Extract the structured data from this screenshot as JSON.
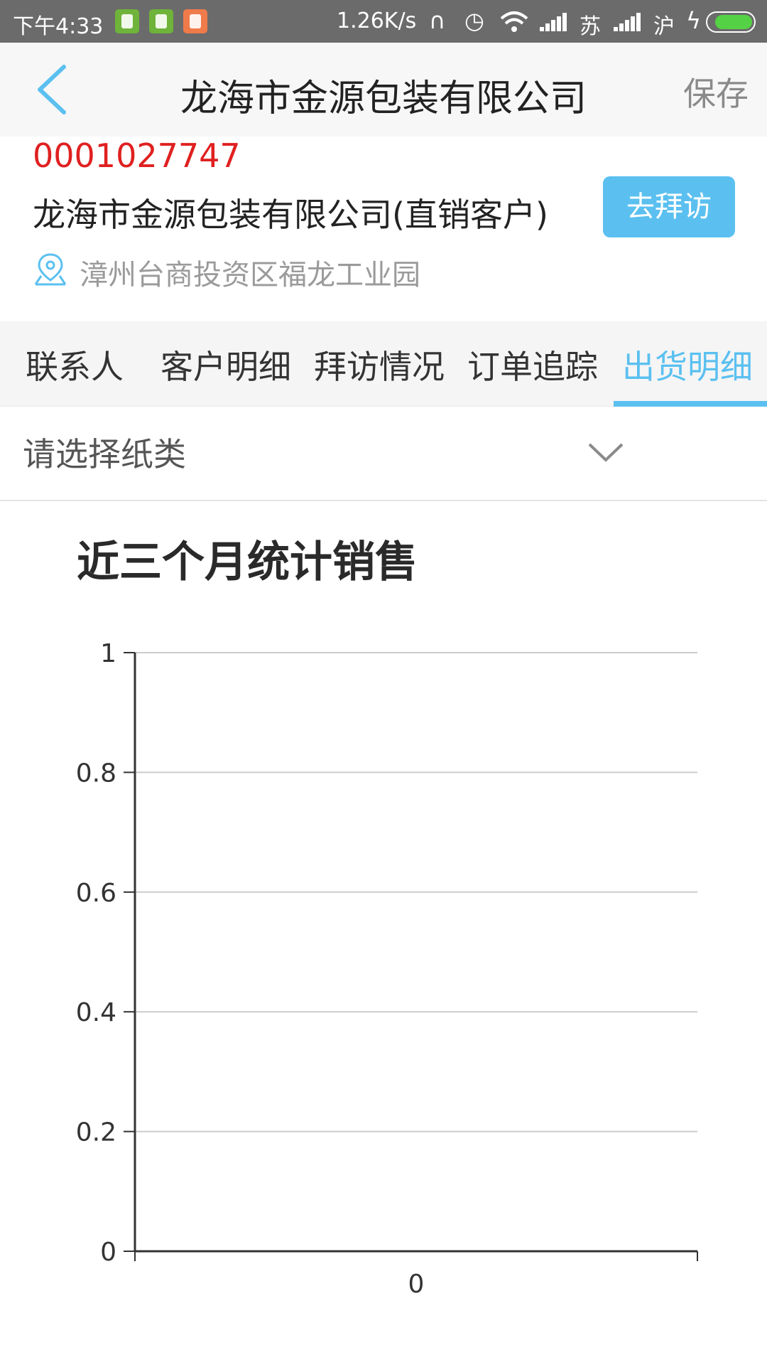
{
  "status_bar": {
    "time": "下午4:33",
    "network_speed": "1.26K/s",
    "carrier_1": "苏",
    "carrier_2": "沪",
    "icons": [
      "app-icon-shield",
      "app-icon-battery",
      "app-icon-mi",
      "headphone-icon",
      "alarm-icon",
      "wifi-icon",
      "signal-icon",
      "signal-icon",
      "charging-icon",
      "battery-icon"
    ],
    "battery_color": "#55d145"
  },
  "header": {
    "title": "龙海市金源包装有限公司",
    "save_label": "保存",
    "back_icon": "chevron-left-icon",
    "accent_color": "#5bc0f0"
  },
  "customer": {
    "code": "0001027747",
    "code_color": "#e02020",
    "name": "龙海市金源包装有限公司(直销客户)",
    "visit_button": "去拜访",
    "address": "漳州台商投资区福龙工业园",
    "location_icon": "location-pin-icon"
  },
  "tabs": [
    {
      "label": "联系人",
      "active": false
    },
    {
      "label": "客户明细",
      "active": false
    },
    {
      "label": "拜访情况",
      "active": false
    },
    {
      "label": "订单追踪",
      "active": false
    },
    {
      "label": "出货明细",
      "active": true
    }
  ],
  "filter": {
    "placeholder": "请选择纸类",
    "icon": "chevron-down-icon"
  },
  "chart_title": "近三个月统计销售",
  "chart_data": {
    "type": "bar",
    "title": "近三个月统计销售",
    "categories": [
      "0"
    ],
    "values": [],
    "ylim": [
      0,
      1
    ],
    "y_ticks": [
      "0",
      "0.2",
      "0.4",
      "0.6",
      "0.8",
      "1"
    ],
    "grid": true,
    "xlabel": "",
    "ylabel": ""
  }
}
